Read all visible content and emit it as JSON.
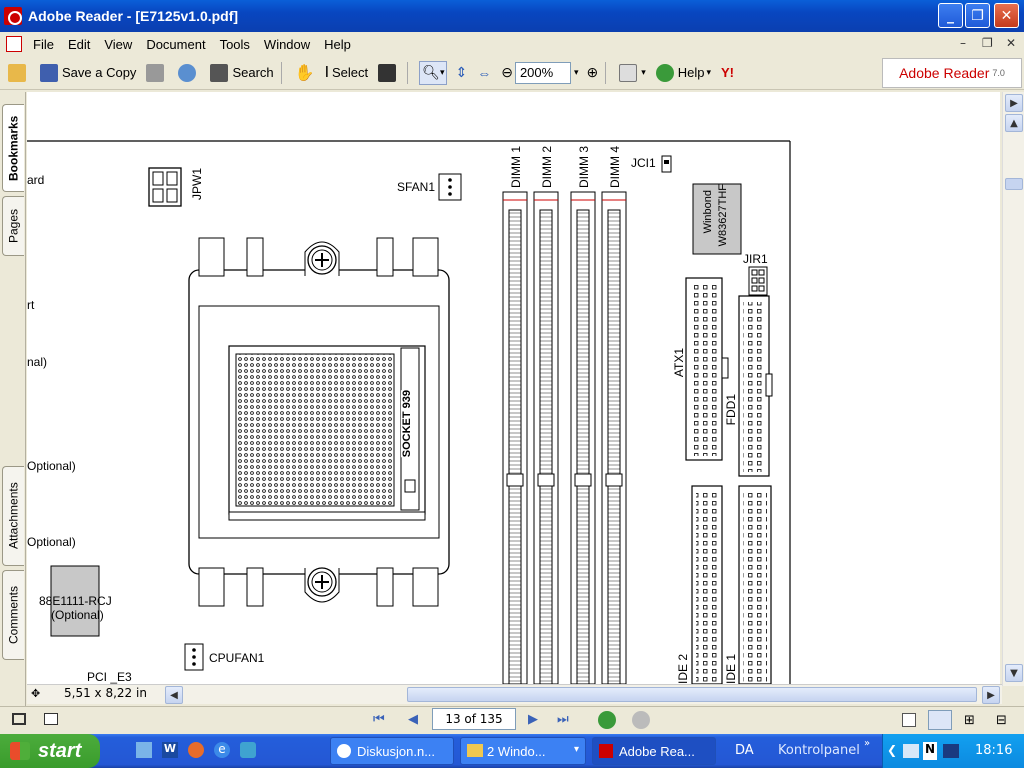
{
  "window": {
    "title": "Adobe Reader - [E7125v1.0.pdf]"
  },
  "menubar": {
    "items": [
      "File",
      "Edit",
      "View",
      "Document",
      "Tools",
      "Window",
      "Help"
    ]
  },
  "toolbar": {
    "save_copy": "Save a Copy",
    "search": "Search",
    "select": "Select",
    "zoom": "200%",
    "help": "Help"
  },
  "brand": {
    "name": "Adobe Reader",
    "version": "7.0"
  },
  "side_tabs": {
    "bookmarks": "Bookmarks",
    "pages": "Pages",
    "attachments": "Attachments",
    "comments": "Comments"
  },
  "document": {
    "labels": {
      "ard": "ard",
      "rt": "rt",
      "nal": "nal)",
      "opt1": "Optional)",
      "opt2": "Optional)",
      "jpw1": "JPW1",
      "sfan1": "SFAN1",
      "jci1": "JCI1",
      "jir1": "JIR1",
      "dimm1": "DIMM 1",
      "dimm2": "DIMM 2",
      "dimm3": "DIMM 3",
      "dimm4": "DIMM 4",
      "winbond": "Winbond",
      "w836": "W83627THF",
      "atx1": "ATX1",
      "fdd1": "FDD1",
      "socket": "SOCKET 939",
      "chip1": "88E1111-RCJ",
      "chip2": "(Optional)",
      "cpufan1": "CPUFAN1",
      "pci": "PCI _E3",
      "ide2": "IDE 2",
      "ide1": "IDE 1"
    }
  },
  "status": {
    "page_size": "5,51 x 8,22 in",
    "page_indicator": "13 of 135"
  },
  "taskbar": {
    "start": "start",
    "tasks": [
      "Diskusjon.n...",
      "2 Windo...",
      "Adobe Rea..."
    ],
    "lang": "DA",
    "kontrol": "Kontrolpanel",
    "clock": "18:16"
  }
}
